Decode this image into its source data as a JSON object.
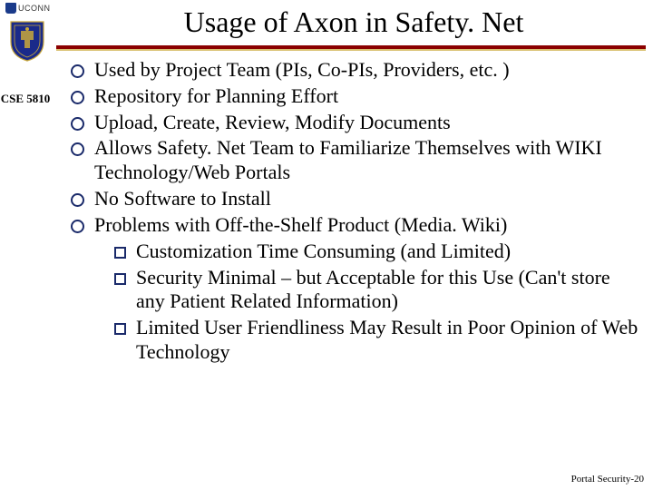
{
  "logo": {
    "text": "UCONN"
  },
  "course": "CSE 5810",
  "title": "Usage of Axon in Safety. Net",
  "bullets": [
    {
      "text": "Used by Project Team (PIs, Co-PIs, Providers, etc. )"
    },
    {
      "text": "Repository for Planning Effort"
    },
    {
      "text": "Upload, Create, Review, Modify Documents"
    },
    {
      "text": "Allows Safety. Net Team to Familiarize Themselves with WIKI Technology/Web Portals"
    },
    {
      "text": "No Software to Install"
    },
    {
      "text": "Problems with Off-the-Shelf Product (Media. Wiki)",
      "sub": [
        "Customization Time Consuming (and Limited)",
        "Security Minimal – but Acceptable for this Use (Can't store any Patient Related Information)",
        "Limited User Friendliness May Result in Poor Opinion of Web Technology"
      ]
    }
  ],
  "footer": "Portal Security-20"
}
